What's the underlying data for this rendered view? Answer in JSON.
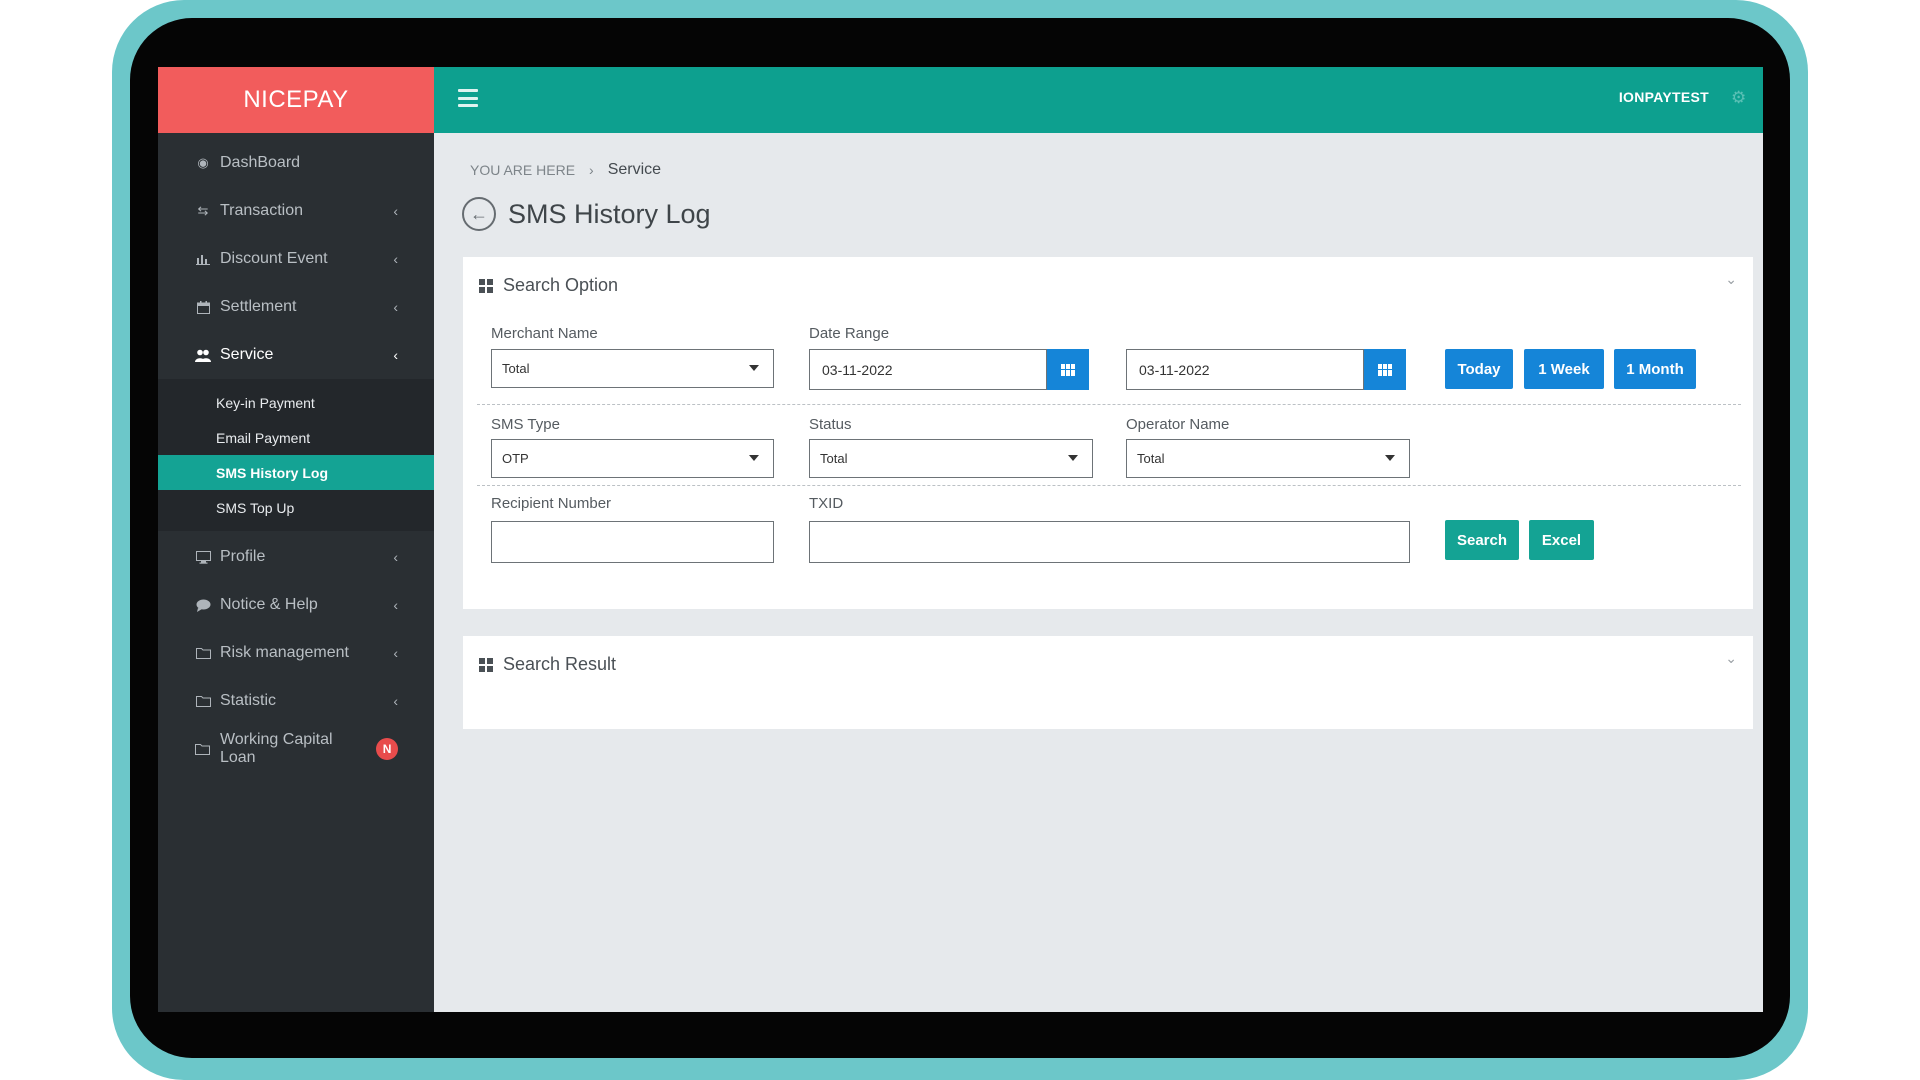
{
  "brand": "NICEPAY",
  "user": "IONPAYTEST",
  "sidebar": {
    "items": [
      {
        "label": "DashBoard",
        "icon": "dashboard-icon"
      },
      {
        "label": "Transaction",
        "icon": "exchange-icon"
      },
      {
        "label": "Discount Event",
        "icon": "bar-chart-icon"
      },
      {
        "label": "Settlement",
        "icon": "calendar-icon"
      },
      {
        "label": "Service",
        "icon": "users-icon"
      },
      {
        "label": "Profile",
        "icon": "monitor-icon"
      },
      {
        "label": "Notice & Help",
        "icon": "chat-bubble-icon"
      },
      {
        "label": "Risk management",
        "icon": "folder-icon"
      },
      {
        "label": "Statistic",
        "icon": "folder-icon"
      },
      {
        "label": "Working Capital Loan",
        "icon": "folder-icon",
        "badge": "N"
      }
    ],
    "service_sub": [
      {
        "label": "Key-in Payment"
      },
      {
        "label": "Email Payment"
      },
      {
        "label": "SMS History Log"
      },
      {
        "label": "SMS Top Up"
      }
    ]
  },
  "breadcrumb": {
    "prefix": "YOU ARE HERE",
    "current": "Service"
  },
  "page_title": "SMS History Log",
  "search_option": {
    "title": "Search Option",
    "merchant_name": {
      "label": "Merchant Name",
      "value": "Total"
    },
    "date_range": {
      "label": "Date Range",
      "from": "03-11-2022",
      "to": "03-11-2022"
    },
    "quick_buttons": {
      "today": "Today",
      "week": "1 Week",
      "month": "1 Month"
    },
    "sms_type": {
      "label": "SMS Type",
      "value": "OTP"
    },
    "status": {
      "label": "Status",
      "value": "Total"
    },
    "operator_name": {
      "label": "Operator Name",
      "value": "Total"
    },
    "recipient_number": {
      "label": "Recipient Number",
      "value": ""
    },
    "txid": {
      "label": "TXID",
      "value": ""
    },
    "search_label": "Search",
    "excel_label": "Excel"
  },
  "search_result": {
    "title": "Search Result"
  },
  "colors": {
    "brand": "#f25c5c",
    "topbar": "#0da08f",
    "sidebar": "#2a2f33",
    "primary": "#1585d8",
    "accent": "#14a394"
  }
}
